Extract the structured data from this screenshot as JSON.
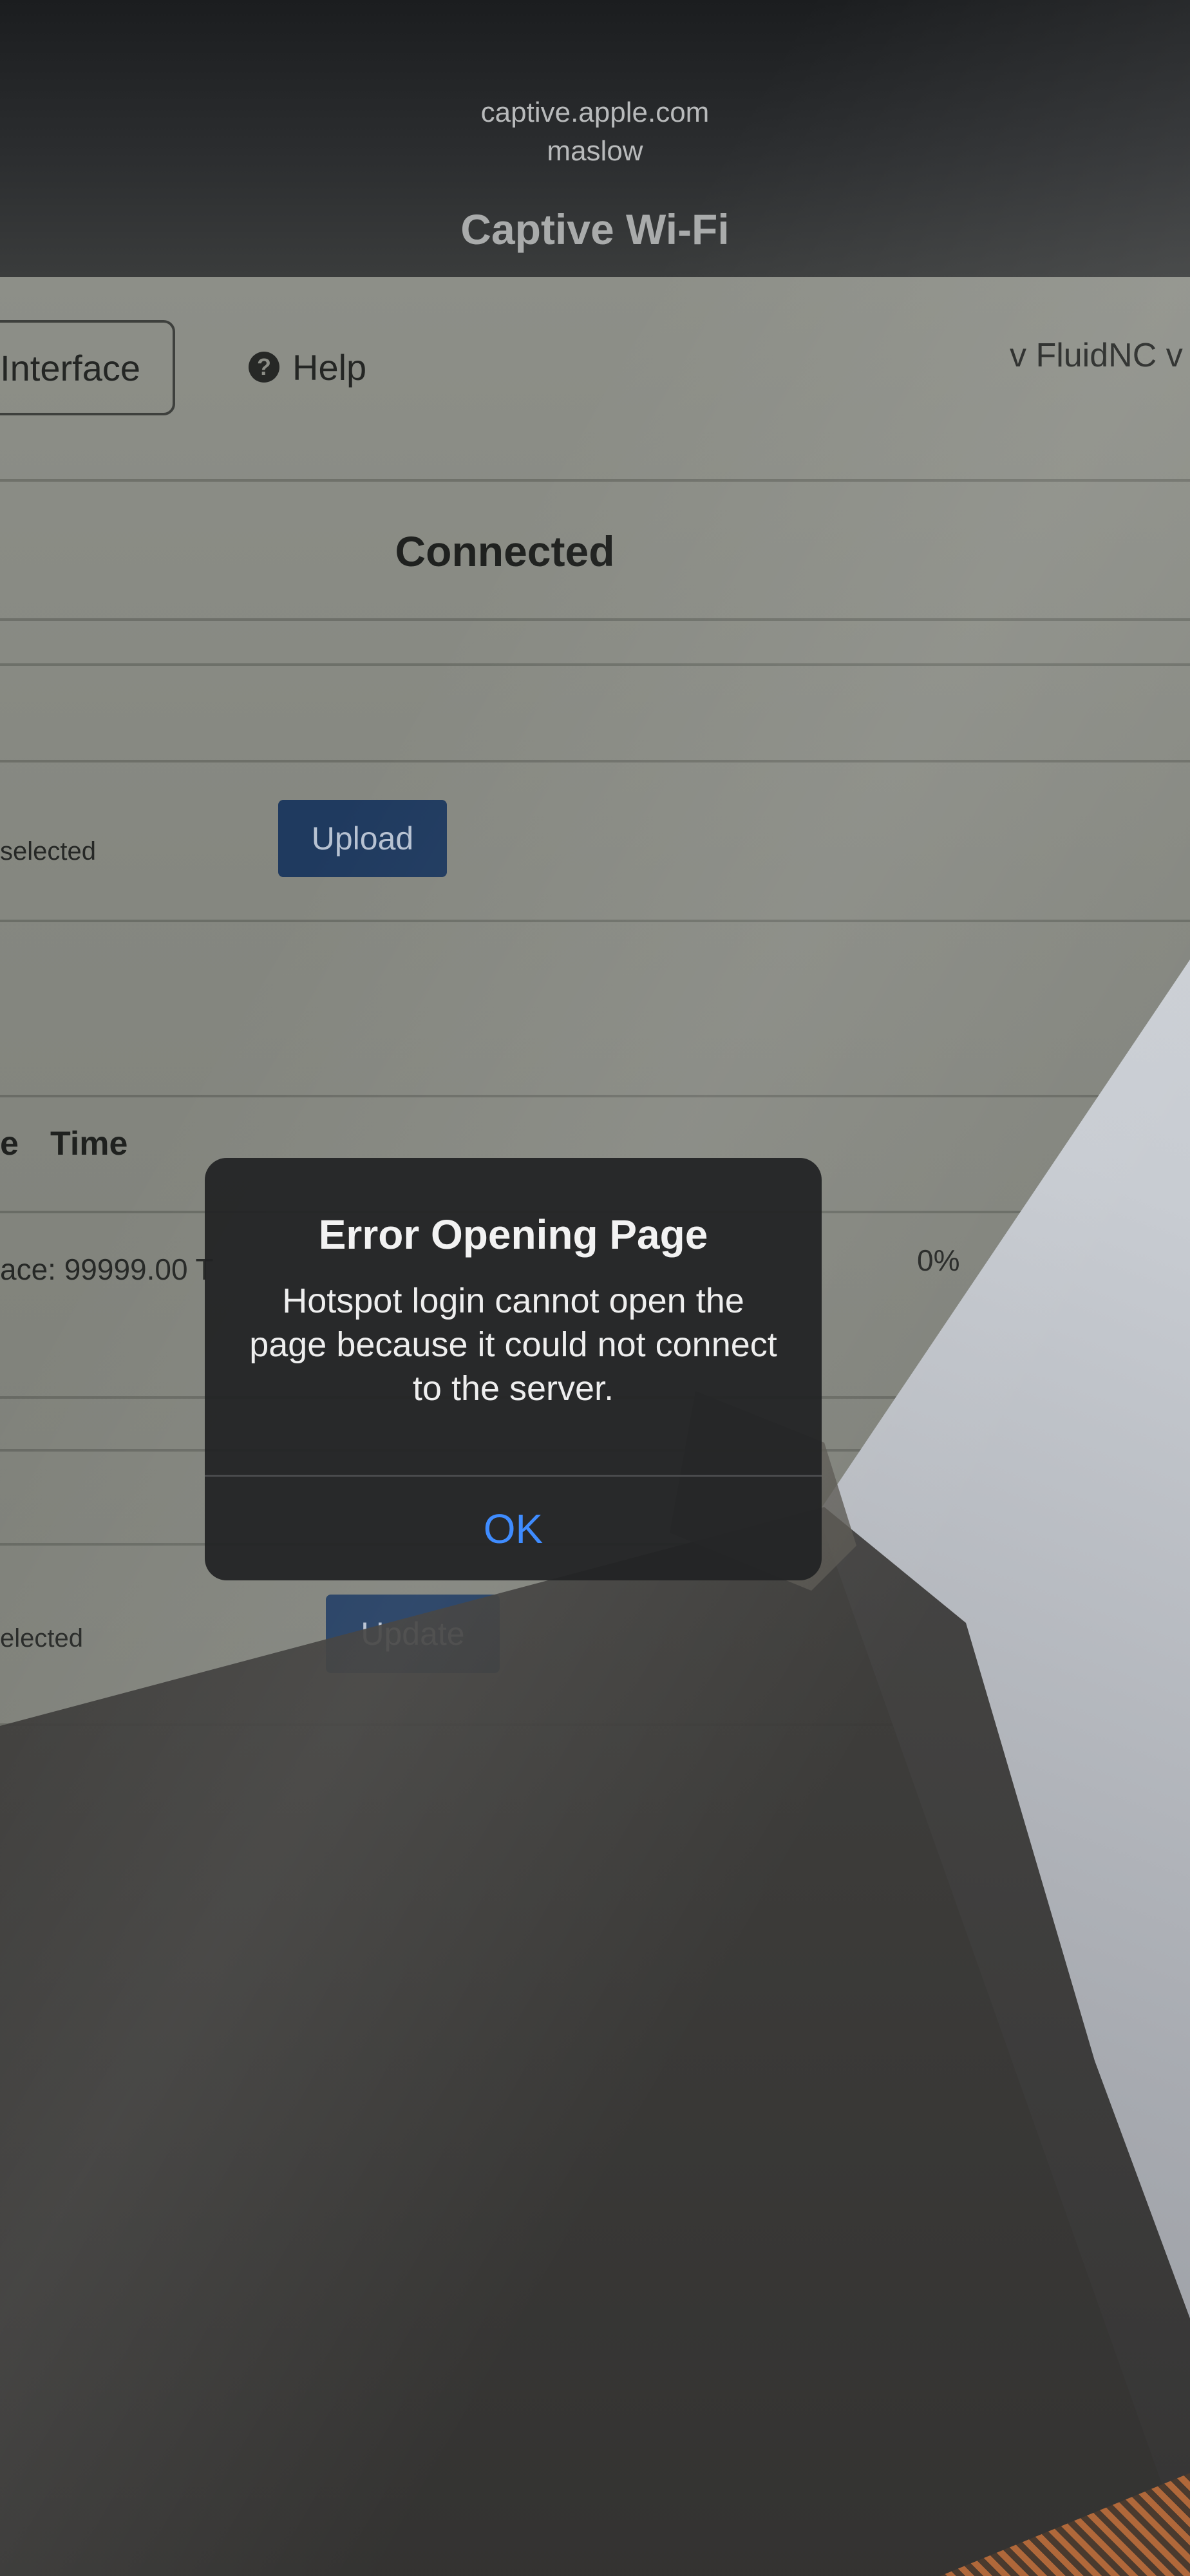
{
  "header": {
    "host": "captive.apple.com",
    "ssid": "maslow",
    "title": "Captive Wi-Fi"
  },
  "page": {
    "nav_interface_label": "Interface",
    "nav_help_label": "Help",
    "help_icon_glyph": "?",
    "version": "v FluidNC v",
    "status": "Connected",
    "file_status_1": "selected",
    "upload_label": "Upload",
    "column_e": "e",
    "column_time": "Time",
    "distance_row": "ace: 99999.00 T",
    "progress": "0%",
    "file_status_2": "elected",
    "update_label": "Update"
  },
  "alert": {
    "title": "Error Opening Page",
    "message": "Hotspot login cannot open the page because it could not connect to the server.",
    "ok_label": "OK",
    "ok_color": "#3f8cff"
  }
}
